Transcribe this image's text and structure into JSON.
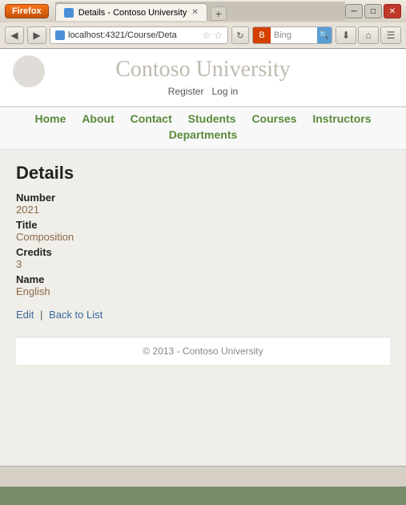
{
  "browser": {
    "firefox_label": "Firefox",
    "tab_title": "Details - Contoso University",
    "address": "localhost:4321/Course/Deta",
    "search_placeholder": "Bing",
    "new_tab_icon": "+",
    "back_icon": "◀",
    "forward_icon": "▶",
    "refresh_icon": "↻",
    "minimize_icon": "─",
    "maximize_icon": "□",
    "close_icon": "✕",
    "download_icon": "⬇",
    "home_icon": "⌂",
    "bookmark_icon": "☆"
  },
  "site": {
    "title": "Contoso University",
    "auth": {
      "register": "Register",
      "login": "Log in"
    },
    "nav": {
      "row1": [
        "Home",
        "About",
        "Contact",
        "Students",
        "Courses",
        "Instructors"
      ],
      "row2": [
        "Departments"
      ]
    },
    "footer": "© 2013 - Contoso University"
  },
  "details": {
    "page_title": "Details",
    "fields": [
      {
        "label": "Number",
        "value": "2021"
      },
      {
        "label": "Title",
        "value": "Composition"
      },
      {
        "label": "Credits",
        "value": "3"
      },
      {
        "label": "Name",
        "value": "English"
      }
    ],
    "actions": {
      "edit": "Edit",
      "separator": "|",
      "back": "Back to List"
    }
  }
}
